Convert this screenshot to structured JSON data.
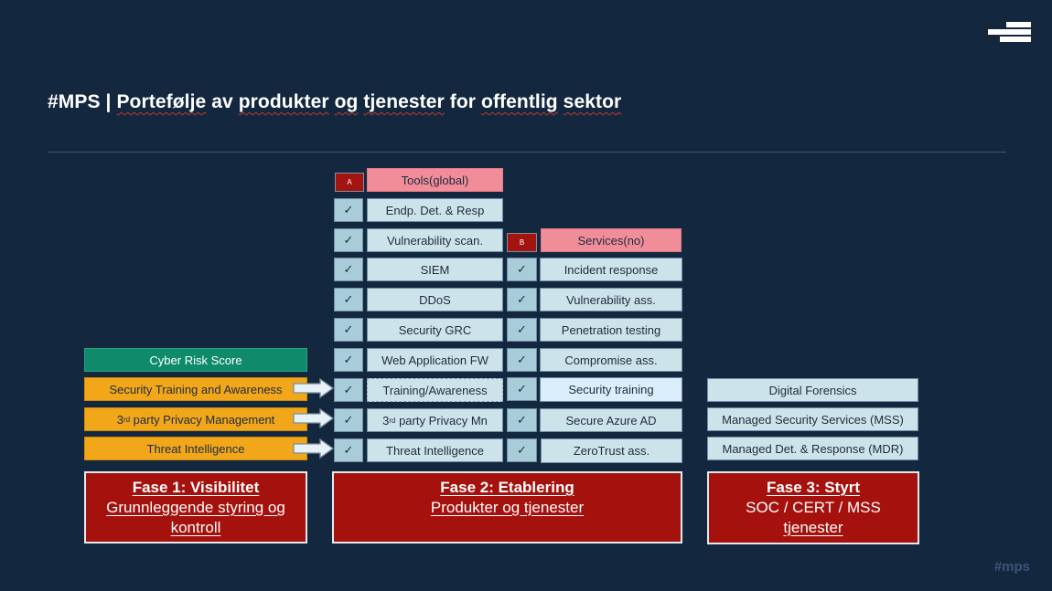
{
  "header": {
    "title_prefix": "#MPS | ",
    "title_words": [
      "Portefølje",
      " av ",
      "produkter",
      " ",
      "og",
      " ",
      "tjenester",
      " for ",
      "offentlig",
      " ",
      "sektor"
    ],
    "logo_icon": "stacked-bars-logo-icon"
  },
  "colors": {
    "background": "#13283f",
    "cell": "#cde3ea",
    "check": "#a9ccd9",
    "header_pink": "#f18d99",
    "badge_red": "#a31410",
    "phase_red": "#a5110c",
    "orange": "#f2a71b",
    "green": "#0f8b6b"
  },
  "fase1": {
    "items": [
      {
        "label": "Cyber Risk Score",
        "style": "green"
      },
      {
        "label": "Security Training and Awareness",
        "style": "orange",
        "arrow": true
      },
      {
        "label_pre": "3",
        "label_sup": "rd",
        "label_post": " party Privacy Management",
        "style": "orange",
        "arrow": true
      },
      {
        "label": "Threat Intelligence",
        "style": "orange",
        "arrow": true
      }
    ],
    "title": "Fase 1: Visibilitet",
    "subtitle_line1": "Grunnleggende styring og",
    "subtitle_line2": "kontroll"
  },
  "tools": {
    "badge": "A",
    "header": "Tools(global)",
    "check_glyph": "✓",
    "items": [
      "Endp. Det. & Resp",
      "Vulnerability scan.",
      "SIEM",
      "DDoS",
      "Security GRC",
      "Web Application FW",
      "Training/Awareness",
      "3rd party Privacy Mn",
      "Threat Intelligence"
    ],
    "privacy_pre": "3",
    "privacy_sup": "rd",
    "privacy_post": " party Privacy Mn"
  },
  "services": {
    "badge": "B",
    "header": "Services(no)",
    "check_glyph": "✓",
    "items": [
      "Incident response",
      "Vulnerability ass.",
      "Penetration testing",
      "Compromise ass.",
      "Security training",
      "Secure Azure AD",
      "ZeroTrust ass."
    ]
  },
  "fase2": {
    "title": "Fase 2: Etablering",
    "subtitle": "Produkter og tjenester"
  },
  "fase3": {
    "items": [
      "Digital Forensics",
      "Managed Security Services (MSS)",
      "Managed Det. & Response (MDR)"
    ],
    "title": "Fase 3: Styrt",
    "subtitle_line1": "SOC / CERT / MSS",
    "subtitle_line2": "tjenester"
  },
  "footer": {
    "tag": "#mps"
  }
}
